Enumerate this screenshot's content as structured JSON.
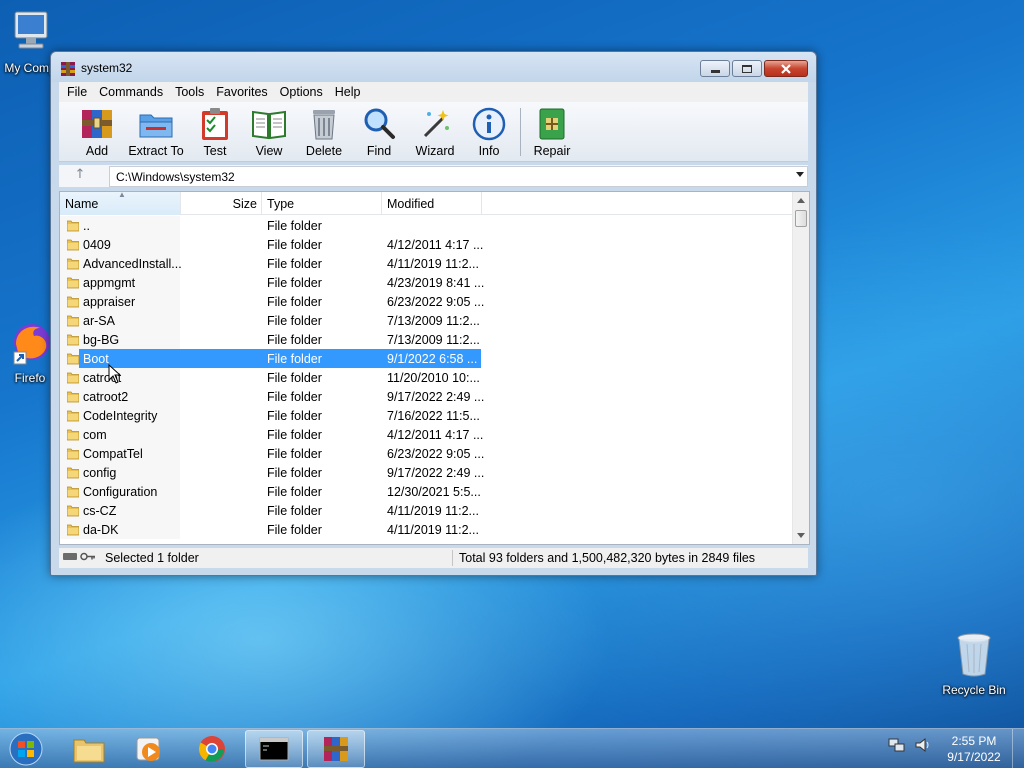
{
  "desktop": {
    "icons": [
      {
        "label": "My Comp",
        "icon": "computer-icon"
      },
      {
        "label": "Firefo",
        "icon": "firefox-icon"
      },
      {
        "label": "Recycle Bin",
        "icon": "recycle-bin-icon"
      }
    ]
  },
  "window": {
    "title": "system32",
    "menu": [
      "File",
      "Commands",
      "Tools",
      "Favorites",
      "Options",
      "Help"
    ],
    "toolbar": [
      {
        "label": "Add",
        "icon": "add-archive-icon"
      },
      {
        "label": "Extract To",
        "icon": "extract-folder-icon"
      },
      {
        "label": "Test",
        "icon": "test-clipboard-icon"
      },
      {
        "label": "View",
        "icon": "view-book-icon"
      },
      {
        "label": "Delete",
        "icon": "trash-icon"
      },
      {
        "label": "Find",
        "icon": "magnifier-icon"
      },
      {
        "label": "Wizard",
        "icon": "wand-icon"
      },
      {
        "label": "Info",
        "icon": "info-icon"
      },
      {
        "label": "Repair",
        "icon": "repair-kit-icon"
      }
    ],
    "address": "C:\\Windows\\system32",
    "columns": [
      "Name",
      "Size",
      "Type",
      "Modified"
    ],
    "rows": [
      {
        "name": "..",
        "type": "File folder",
        "modified": ""
      },
      {
        "name": "0409",
        "type": "File folder",
        "modified": "4/12/2011 4:17 ..."
      },
      {
        "name": "AdvancedInstall...",
        "type": "File folder",
        "modified": "4/11/2019 11:2..."
      },
      {
        "name": "appmgmt",
        "type": "File folder",
        "modified": "4/23/2019 8:41 ..."
      },
      {
        "name": "appraiser",
        "type": "File folder",
        "modified": "6/23/2022 9:05 ..."
      },
      {
        "name": "ar-SA",
        "type": "File folder",
        "modified": "7/13/2009 11:2..."
      },
      {
        "name": "bg-BG",
        "type": "File folder",
        "modified": "7/13/2009 11:2..."
      },
      {
        "name": "Boot",
        "type": "File folder",
        "modified": "9/1/2022 6:58 ...",
        "selected": true
      },
      {
        "name": "catroot",
        "type": "File folder",
        "modified": "11/20/2010 10:..."
      },
      {
        "name": "catroot2",
        "type": "File folder",
        "modified": "9/17/2022 2:49 ..."
      },
      {
        "name": "CodeIntegrity",
        "type": "File folder",
        "modified": "7/16/2022 11:5..."
      },
      {
        "name": "com",
        "type": "File folder",
        "modified": "4/12/2011 4:17 ..."
      },
      {
        "name": "CompatTel",
        "type": "File folder",
        "modified": "6/23/2022 9:05 ..."
      },
      {
        "name": "config",
        "type": "File folder",
        "modified": "9/17/2022 2:49 ..."
      },
      {
        "name": "Configuration",
        "type": "File folder",
        "modified": "12/30/2021 5:5..."
      },
      {
        "name": "cs-CZ",
        "type": "File folder",
        "modified": "4/11/2019 11:2..."
      },
      {
        "name": "da-DK",
        "type": "File folder",
        "modified": "4/11/2019 11:2..."
      }
    ],
    "status_left": "Selected 1 folder",
    "status_right": "Total 93 folders and 1,500,482,320 bytes in 2849 files"
  },
  "taskbar": {
    "apps": [
      "explorer-icon",
      "media-player-icon",
      "chrome-icon",
      "cmd-icon",
      "winrar-icon"
    ],
    "time": "2:55 PM",
    "date": "9/17/2022"
  },
  "colors": {
    "selection": "#3399ff",
    "taskbar": "#5b86b6"
  }
}
